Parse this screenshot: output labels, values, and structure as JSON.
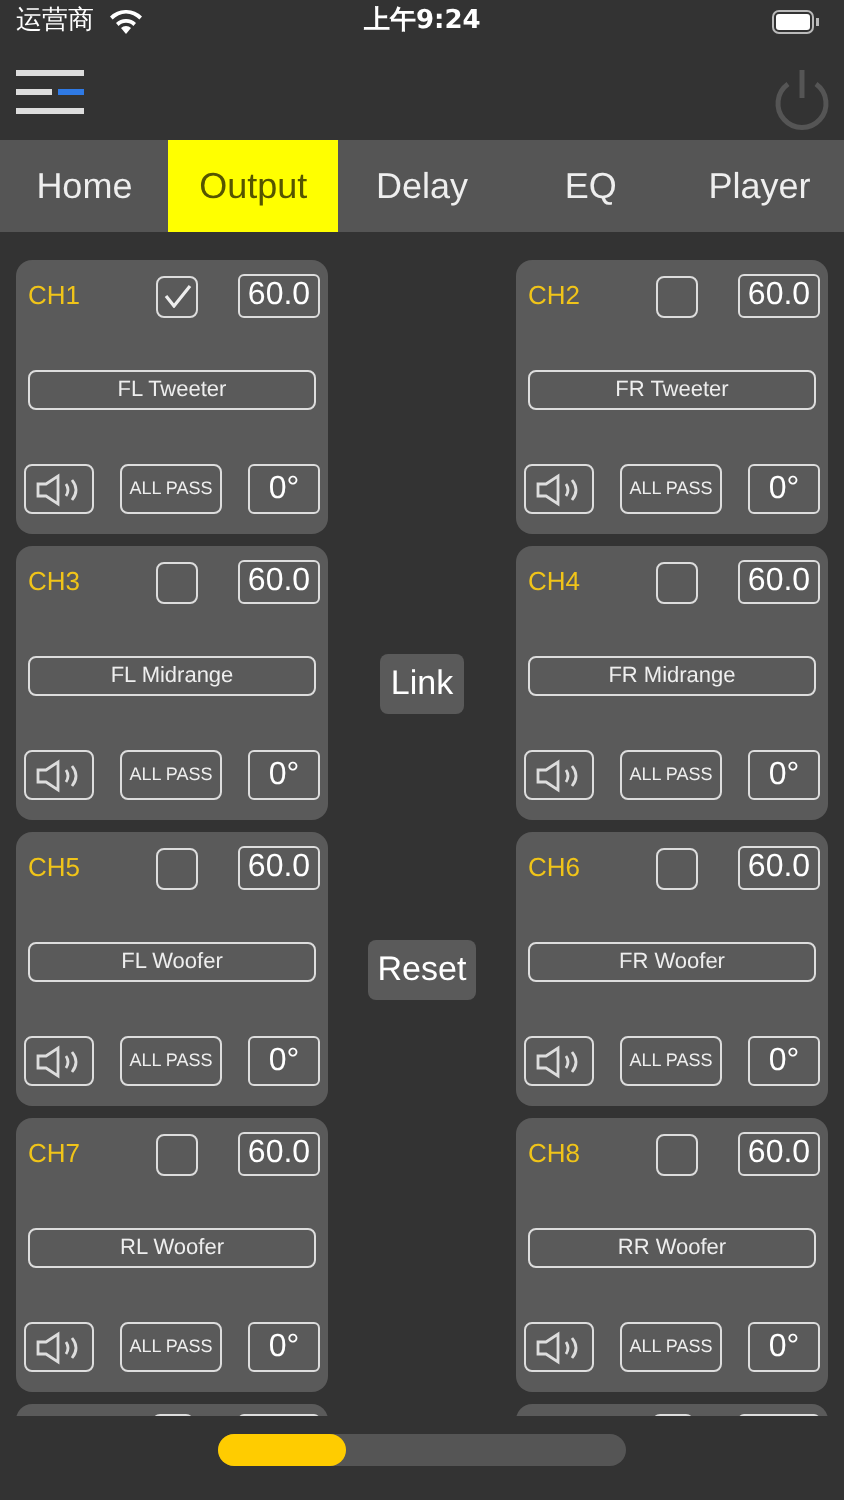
{
  "status_bar": {
    "carrier": "运营商",
    "time": "上午9:24"
  },
  "tabs": [
    {
      "label": "Home",
      "selected": false
    },
    {
      "label": "Output",
      "selected": true
    },
    {
      "label": "Delay",
      "selected": false
    },
    {
      "label": "EQ",
      "selected": false
    },
    {
      "label": "Player",
      "selected": false
    }
  ],
  "rows": [
    {
      "channels": [
        {
          "label": "CH1",
          "checked": true,
          "gain": "60.0",
          "name": "FL Tweeter",
          "filter": "ALL PASS",
          "phase": "0°"
        },
        {
          "label": "CH2",
          "checked": false,
          "gain": "60.0",
          "name": "FR Tweeter",
          "filter": "ALL PASS",
          "phase": "0°"
        }
      ]
    },
    {
      "channels": [
        {
          "label": "CH3",
          "checked": false,
          "gain": "60.0",
          "name": "FL Midrange",
          "filter": "ALL PASS",
          "phase": "0°"
        },
        {
          "label": "CH4",
          "checked": false,
          "gain": "60.0",
          "name": "FR Midrange",
          "filter": "ALL PASS",
          "phase": "0°"
        }
      ],
      "action": "Link"
    },
    {
      "channels": [
        {
          "label": "CH5",
          "checked": false,
          "gain": "60.0",
          "name": "FL Woofer",
          "filter": "ALL PASS",
          "phase": "0°"
        },
        {
          "label": "CH6",
          "checked": false,
          "gain": "60.0",
          "name": "FR Woofer",
          "filter": "ALL PASS",
          "phase": "0°"
        }
      ],
      "action": "Reset"
    },
    {
      "channels": [
        {
          "label": "CH7",
          "checked": false,
          "gain": "60.0",
          "name": "RL Woofer",
          "filter": "ALL PASS",
          "phase": "0°"
        },
        {
          "label": "CH8",
          "checked": false,
          "gain": "60.0",
          "name": "RR Woofer",
          "filter": "ALL PASS",
          "phase": "0°"
        }
      ]
    }
  ]
}
